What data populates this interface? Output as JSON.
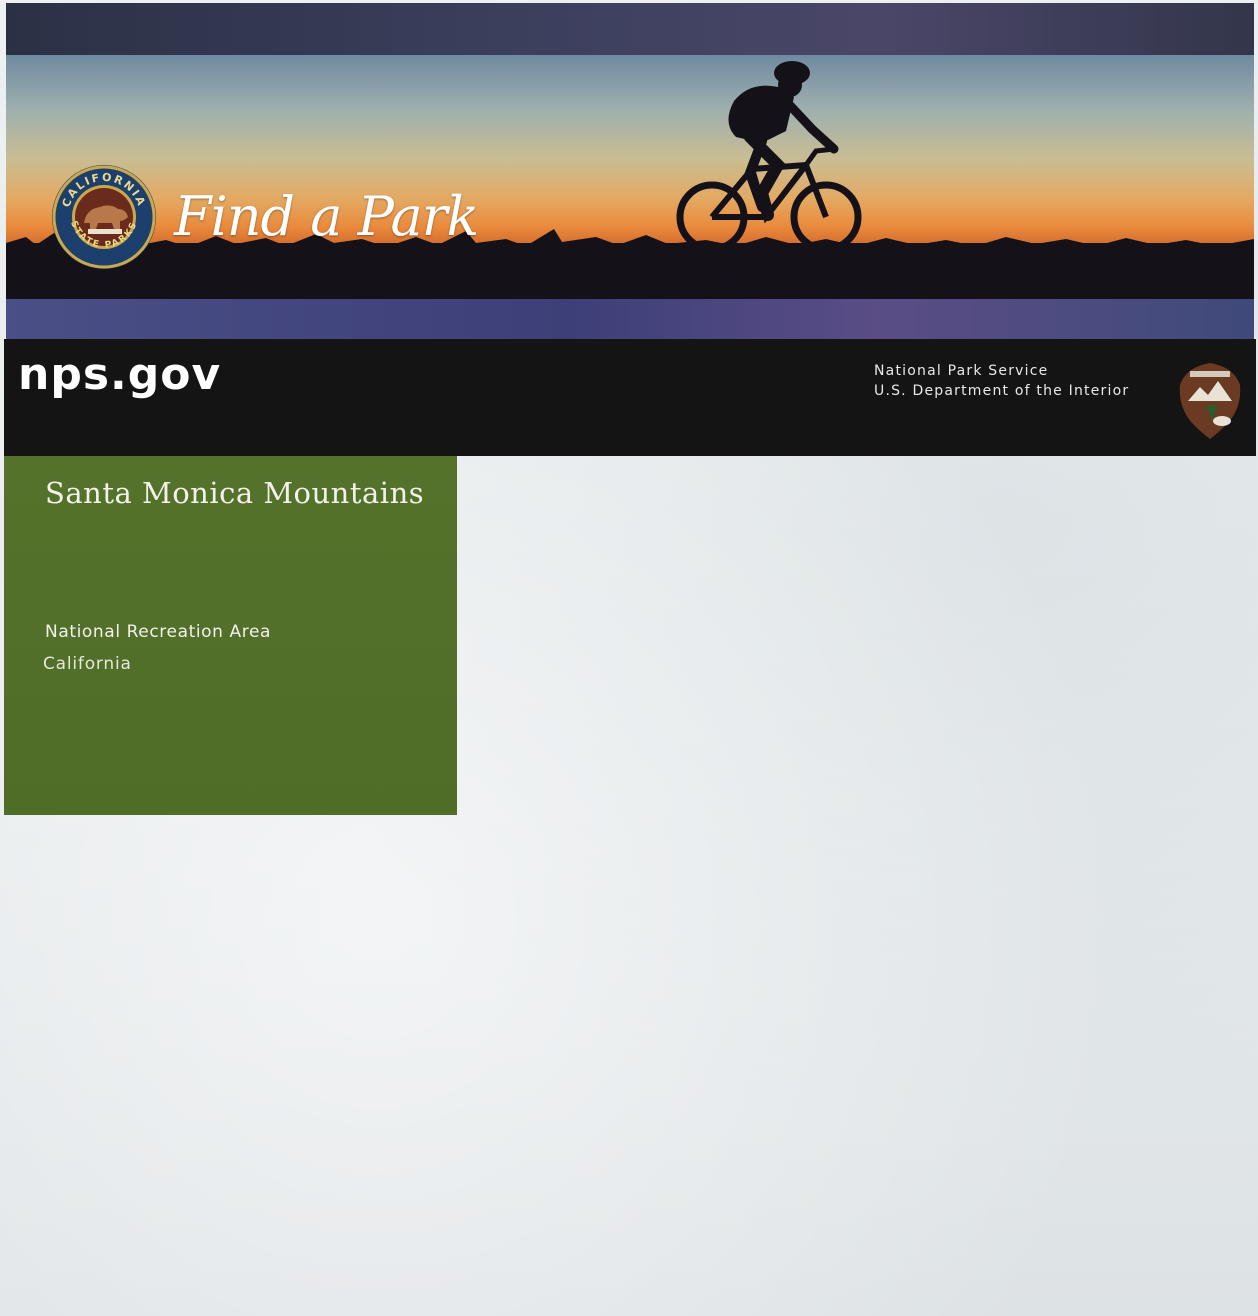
{
  "banner": {
    "heading": "Find a Park",
    "seal_text": "CALIFORNIA STATE PARKS",
    "seal_icon": "california-state-parks-bear-seal-icon",
    "cyclist_icon": "mountain-biker-silhouette-icon"
  },
  "nps_header": {
    "site": "nps.gov",
    "agency_line1": "National Park Service",
    "agency_line2": "U.S. Department of the Interior",
    "logo_icon": "nps-arrowhead-icon"
  },
  "title_block": {
    "park_name": "Santa Monica Mountains",
    "park_type": "National Recreation Area",
    "state": "California"
  },
  "colors": {
    "title_block_green": "#52702a",
    "header_black": "#141414",
    "sunset_orange": "#e98a3c",
    "band_blue": "#3d3f78"
  }
}
